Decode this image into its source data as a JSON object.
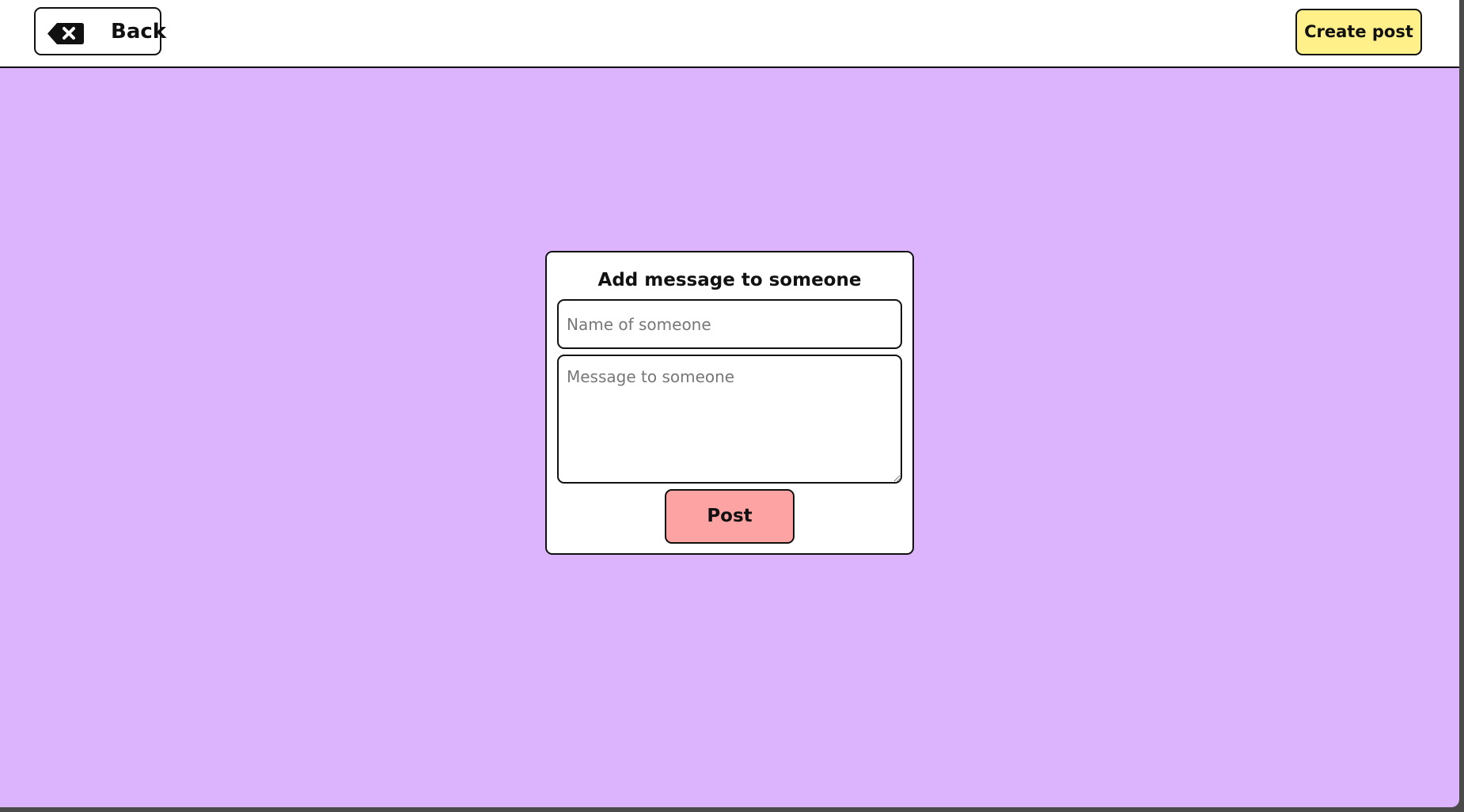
{
  "header": {
    "back_label": "Back",
    "back_icon": "backspace-x-icon",
    "create_post_label": "Create post"
  },
  "form": {
    "title": "Add message to someone",
    "name_placeholder": "Name of someone",
    "name_value": "",
    "message_placeholder": "Message to someone",
    "message_value": "",
    "post_label": "Post"
  },
  "colors": {
    "background": "#dbb4fd",
    "topbar": "#ffffff",
    "create_post_button": "#fff08a",
    "post_button": "#fea3a3",
    "border": "#111111"
  }
}
